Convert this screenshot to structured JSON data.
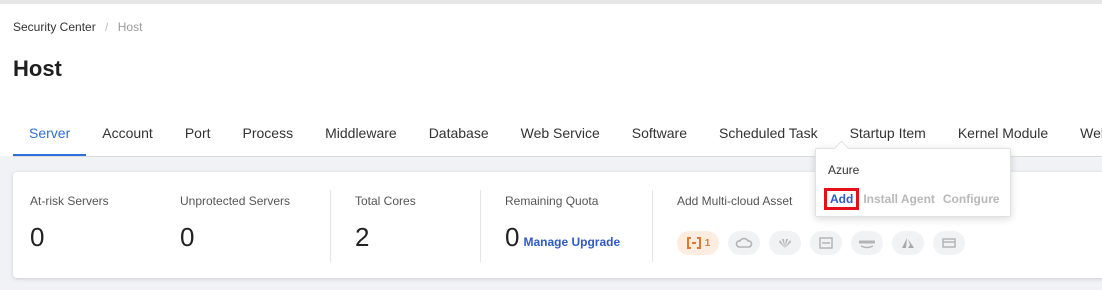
{
  "breadcrumb": {
    "root": "Security Center",
    "separator": "/",
    "current": "Host"
  },
  "page": {
    "title": "Host"
  },
  "tabs": [
    {
      "label": "Server",
      "active": true
    },
    {
      "label": "Account"
    },
    {
      "label": "Port"
    },
    {
      "label": "Process"
    },
    {
      "label": "Middleware"
    },
    {
      "label": "Database"
    },
    {
      "label": "Web Service"
    },
    {
      "label": "Software"
    },
    {
      "label": "Scheduled Task"
    },
    {
      "label": "Startup Item"
    },
    {
      "label": "Kernel Module"
    },
    {
      "label": "Websi"
    }
  ],
  "metrics": {
    "at_risk": {
      "label": "At-risk Servers",
      "value": "0"
    },
    "unprotected": {
      "label": "Unprotected Servers",
      "value": "0"
    },
    "total_cores": {
      "label": "Total Cores",
      "value": "2"
    },
    "remaining_quota": {
      "label": "Remaining Quota",
      "value": "0",
      "link": "Manage Upgrade"
    }
  },
  "multicloud": {
    "label": "Add Multi-cloud Asset",
    "providers": [
      {
        "icon": "alibaba-cloud-icon",
        "badge": "1",
        "active": true
      },
      {
        "icon": "tencent-cloud-icon"
      },
      {
        "icon": "huawei-cloud-icon"
      },
      {
        "icon": "idc-icon"
      },
      {
        "icon": "aws-icon"
      },
      {
        "icon": "azure-icon"
      },
      {
        "icon": "other-cloud-icon"
      }
    ]
  },
  "popover": {
    "title": "Azure",
    "actions": {
      "add": "Add",
      "install": "Install Agent",
      "configure": "Configure"
    }
  },
  "colors": {
    "accent": "#2e6fd8",
    "link": "#2e59c7",
    "highlight": "#e5101a",
    "active_provider": "#e07a2e"
  }
}
